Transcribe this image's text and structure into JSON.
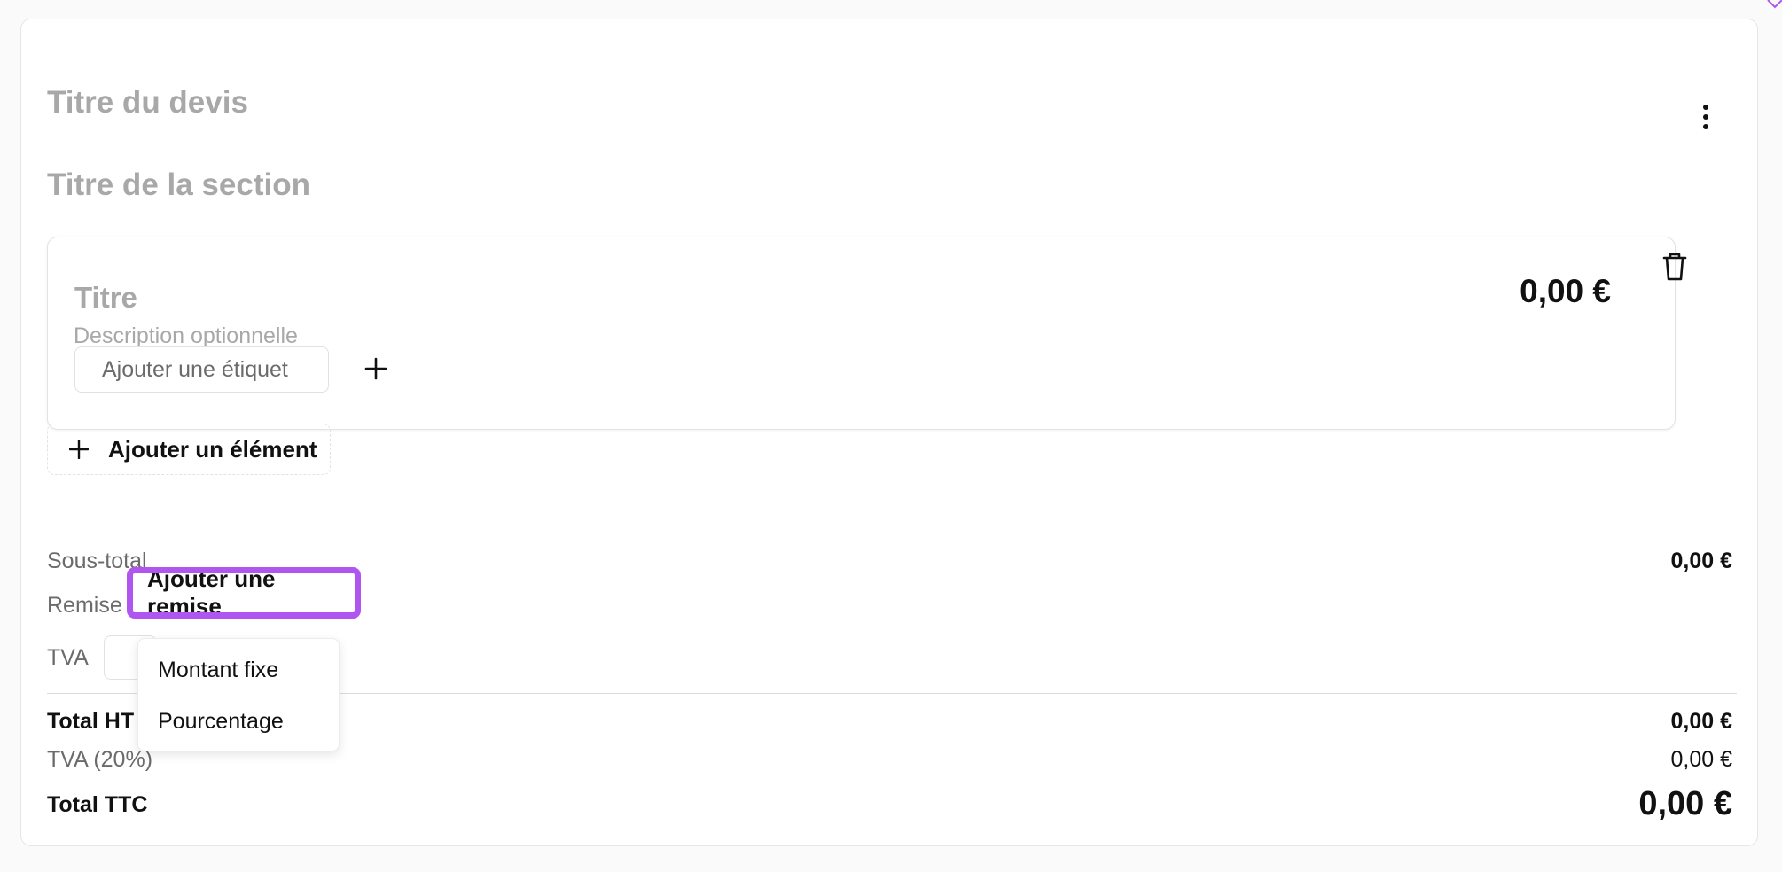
{
  "quote": {
    "title_placeholder": "Titre du devis",
    "section_title_placeholder": "Titre de la section"
  },
  "item": {
    "title_placeholder": "Titre",
    "description_placeholder": "Description optionnelle",
    "price": "0,00 €",
    "tag_placeholder": "Ajouter une étiquet"
  },
  "add_item_label": "Ajouter un élément",
  "summary": {
    "subtotal_label": "Sous-total",
    "subtotal_value": "0,00 €",
    "discount_label": "Remise",
    "discount_button": "Ajouter une remise",
    "tva_label": "TVA",
    "total_ht_label": "Total HT",
    "total_ht_value": "0,00 €",
    "tva_rate_label": "TVA (20%)",
    "tva_rate_value": "0,00 €",
    "total_ttc_label": "Total TTC",
    "total_ttc_value": "0,00 €"
  },
  "discount_menu": {
    "options": [
      "Montant fixe",
      "Pourcentage"
    ]
  },
  "colors": {
    "highlight": "#b055f0",
    "placeholder": "#a8a8a8",
    "muted_text": "#6b6b6b"
  }
}
